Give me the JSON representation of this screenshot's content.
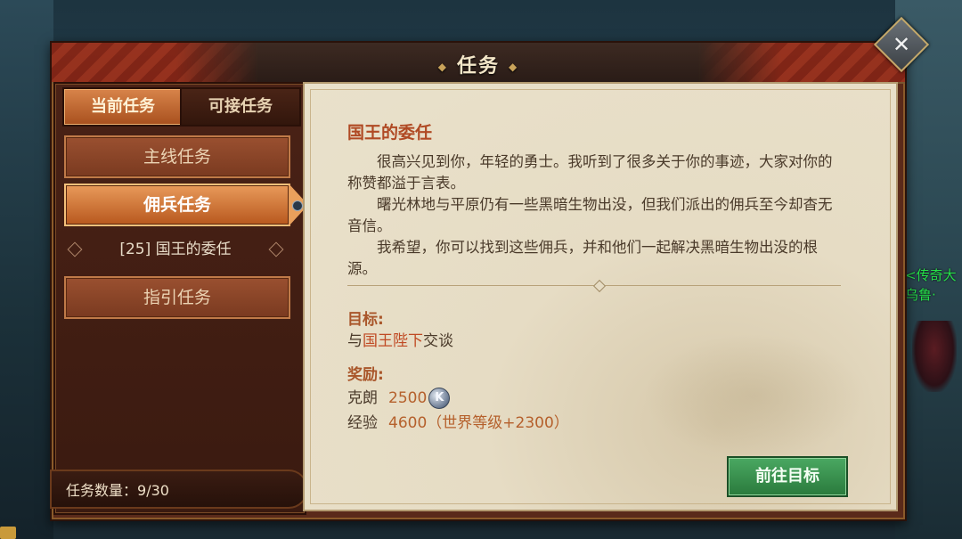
{
  "window": {
    "title": "任务"
  },
  "tabs": [
    {
      "label": "当前任务",
      "active": true
    },
    {
      "label": "可接任务",
      "active": false
    }
  ],
  "categories": [
    {
      "label": "主线任务",
      "active": false
    },
    {
      "label": "佣兵任务",
      "active": true
    },
    {
      "label": "指引任务",
      "active": false
    }
  ],
  "quest_entry": {
    "level": "[25]",
    "name": "国王的委任"
  },
  "footer": {
    "label": "任务数量：",
    "value": "9/30"
  },
  "quest": {
    "title": "国王的委任",
    "paragraphs": [
      "很高兴见到你，年轻的勇士。我听到了很多关于你的事迹，大家对你的称赞都溢于言表。",
      "曙光林地与平原仍有一些黑暗生物出没，但我们派出的佣兵至今却杳无音信。",
      "我希望，你可以找到这些佣兵，并和他们一起解决黑暗生物出没的根源。"
    ],
    "goal_label": "目标:",
    "goal_prefix": "与",
    "goal_target": "国王陛下",
    "goal_suffix": "交谈",
    "reward_label": "奖励:",
    "rewards": [
      {
        "name": "克朗",
        "value": "2500",
        "icon": "crown-coin-icon",
        "icon_glyph": "K"
      },
      {
        "name": "经验",
        "value": "4600（世界等级+2300）"
      }
    ],
    "action_button": "前往目标"
  },
  "background": {
    "npc_name_lines": [
      "<传奇大",
      "乌鲁·"
    ]
  },
  "colors": {
    "quest_title": "#b04a24",
    "highlight": "#c04a24",
    "reward_value": "#b5602c",
    "go_button": "#2a7a3c",
    "npc_name": "#26e04a"
  }
}
